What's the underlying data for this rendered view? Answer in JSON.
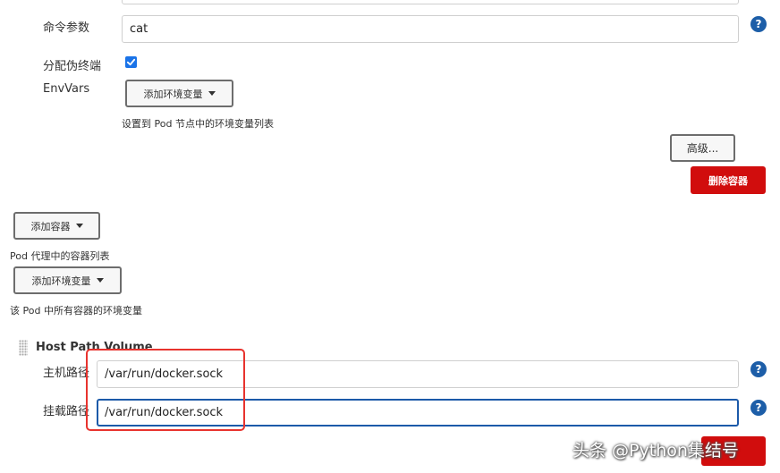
{
  "command_args": {
    "label": "命令参数",
    "value": "cat"
  },
  "pseudo_terminal": {
    "label": "分配伪终端",
    "checked": true
  },
  "env_vars": {
    "label": "EnvVars",
    "add_button": "添加环境变量",
    "description": "设置到 Pod 节点中的环境变量列表"
  },
  "container_actions": {
    "advanced_button": "高级...",
    "delete_button": "删除容器"
  },
  "containers": {
    "add_button": "添加容器",
    "description": "Pod 代理中的容器列表"
  },
  "pod_env": {
    "add_button": "添加环境变量",
    "description": "该 Pod 中所有容器的环境变量"
  },
  "host_path_volume": {
    "title": "Host Path Volume",
    "host_path_label": "主机路径",
    "host_path_value": "/var/run/docker.sock",
    "mount_path_label": "挂载路径",
    "mount_path_value": "/var/run/docker.sock"
  },
  "help_glyph": "?",
  "watermark": "头条 @Python集结号",
  "colors": {
    "accent": "#1d5ea8",
    "danger": "#d10d0d",
    "highlight": "#e8332e",
    "checkbox": "#1a73e8"
  },
  "icons": [
    "help-icon",
    "caret-down-icon",
    "drag-handle-icon",
    "checkmark-icon"
  ]
}
